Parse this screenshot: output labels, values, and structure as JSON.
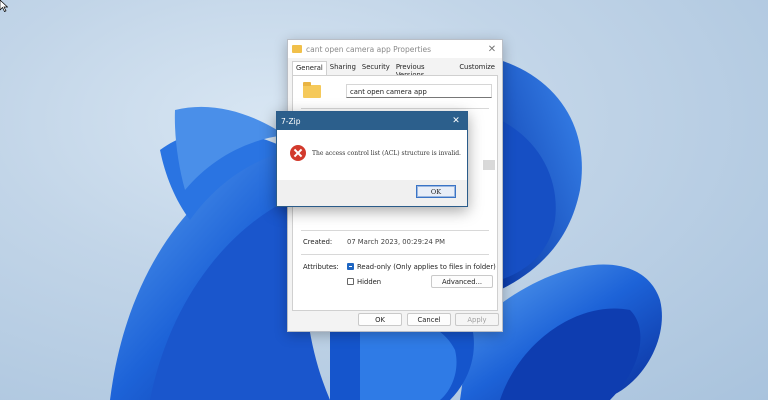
{
  "properties": {
    "title": "cant open camera app Properties",
    "tabs": [
      "General",
      "Sharing",
      "Security",
      "Previous Versions",
      "Customize"
    ],
    "folder_name": "cant open camera app",
    "created_label": "Created:",
    "created_value": "07 March 2023, 00:29:24 PM",
    "attributes_label": "Attributes:",
    "readonly_label": "Read-only (Only applies to files in folder)",
    "readonly_checked": true,
    "hidden_label": "Hidden",
    "hidden_checked": false,
    "advanced_label": "Advanced...",
    "ok_label": "OK",
    "cancel_label": "Cancel",
    "apply_label": "Apply"
  },
  "zip_dialog": {
    "title": "7-Zip",
    "message": "The access control list (ACL) structure is invalid.",
    "ok_label": "OK"
  },
  "icons": {
    "folder": "folder-icon",
    "error": "error-icon",
    "close": "close-icon",
    "cursor": "mouse-cursor-icon"
  },
  "colors": {
    "accent": "#2c5f8c",
    "error": "#d23a2c",
    "checkbox": "#1f66c2"
  }
}
